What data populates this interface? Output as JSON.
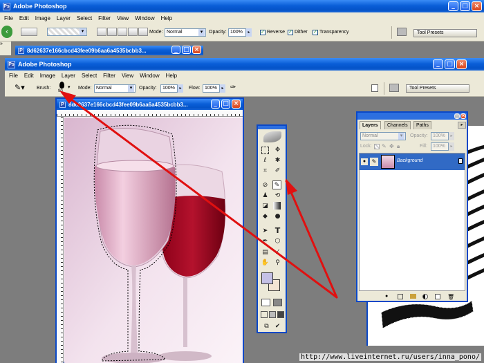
{
  "outer_window": {
    "title": "Adobe Photoshop",
    "menu": [
      "File",
      "Edit",
      "Image",
      "Layer",
      "Select",
      "Filter",
      "View",
      "Window",
      "Help"
    ],
    "options": {
      "mode_label": "Mode:",
      "mode_value": "Normal",
      "opacity_label": "Opacity:",
      "opacity_value": "100%",
      "reverse_label": "Reverse",
      "dither_label": "Dither",
      "transparency_label": "Transparency",
      "tool_presets_label": "Tool Presets"
    },
    "doc_tab_title": "8d62637e166cbcd43fee09b6aa6a4535bcbb3..."
  },
  "inner_window": {
    "title": "Adobe Photoshop",
    "menu": [
      "File",
      "Edit",
      "Image",
      "Layer",
      "Select",
      "Filter",
      "View",
      "Window",
      "Help"
    ],
    "options": {
      "brush_label": "Brush:",
      "brush_size": "90",
      "mode_label": "Mode:",
      "mode_value": "Normal",
      "opacity_label": "Opacity:",
      "opacity_value": "100%",
      "flow_label": "Flow:",
      "flow_value": "100%",
      "tool_presets_label": "Tool Presets"
    },
    "doc_title": "8d62637e166cbcd43fee09b6aa6a4535bcbb3..."
  },
  "layers_panel": {
    "tabs": [
      "Layers",
      "Channels",
      "Paths"
    ],
    "active_tab": "Layers",
    "blend_mode": "Normal",
    "opacity_label": "Opacity:",
    "opacity_value": "100%",
    "lock_label": "Lock:",
    "fill_label": "Fill:",
    "fill_value": "100%",
    "layer_name": "Background"
  },
  "watermark": "http://www.liveinternet.ru/users/inna_pono/",
  "colors": {
    "xp_title": "#0a5fd8",
    "chrome": "#ece9d8",
    "workspace": "#7d7d7d",
    "arrow": "#e01010",
    "selection": "#316ac5"
  },
  "icons": [
    "brush-icon",
    "lasso-icon",
    "move-icon",
    "crop-icon",
    "stamp-icon",
    "eraser-icon",
    "gradient-icon",
    "text-icon",
    "pen-icon",
    "hand-icon",
    "zoom-icon",
    "eye-icon",
    "lock-icon"
  ]
}
